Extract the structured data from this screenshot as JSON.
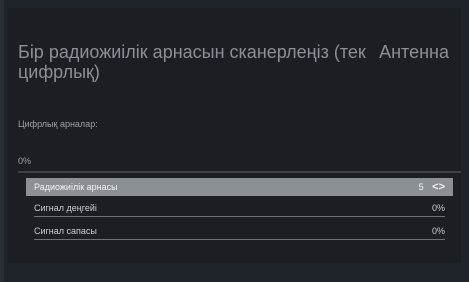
{
  "header": {
    "title": "Бір радиожиілік арнасын сканерлеңіз (тек цифрлық)",
    "source": "Антенна"
  },
  "scan": {
    "digital_channels_label": "Цифрлық арналар:",
    "progress_text": "0%",
    "progress_fraction": 0.0
  },
  "settings": [
    {
      "label": "Радиожиілік арнасы",
      "value": "5",
      "arrows": "<>"
    },
    {
      "label": "Сигнал деңгейі",
      "value": "0%"
    },
    {
      "label": "Сигнал сапасы",
      "value": "0%"
    }
  ],
  "colors": {
    "background": "#1f242a",
    "selected_row": "#8b9095",
    "text_muted": "#8a9096"
  }
}
